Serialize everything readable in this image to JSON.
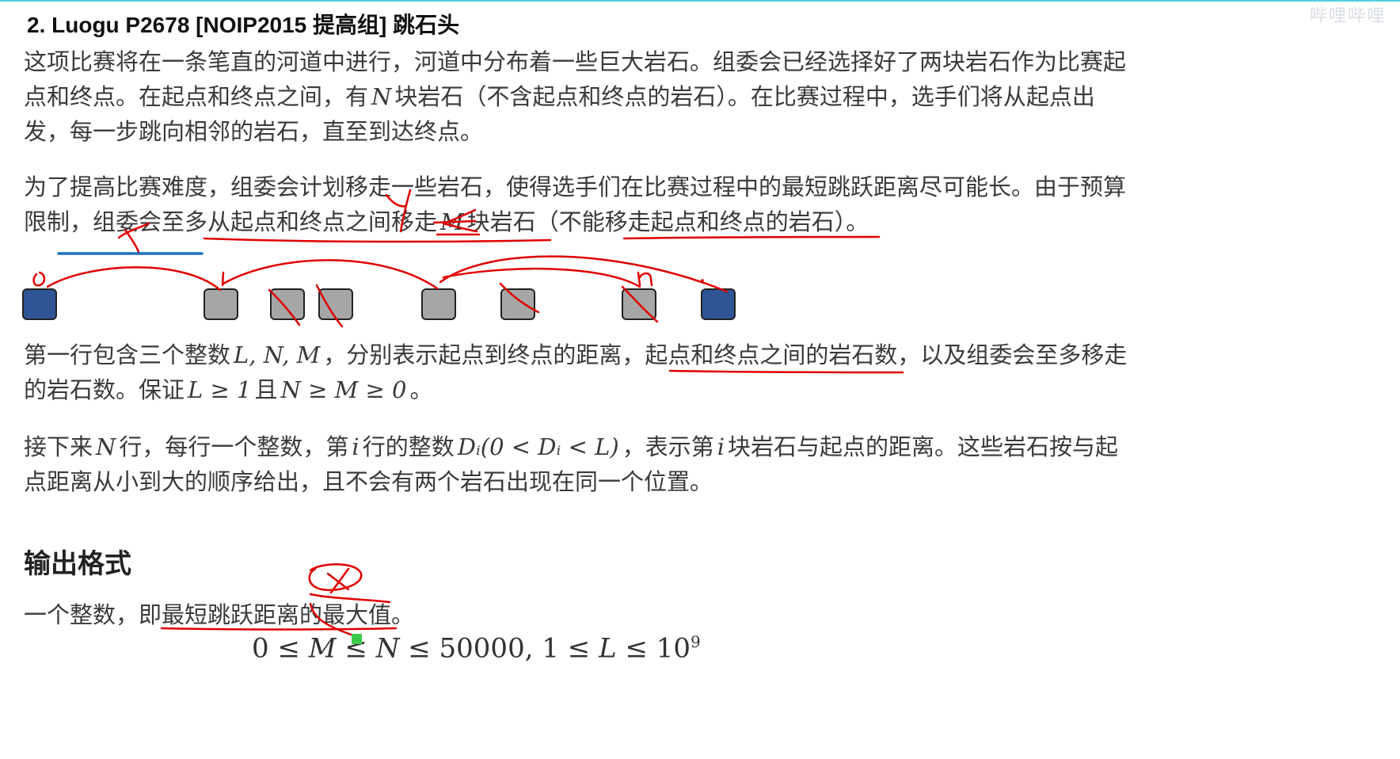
{
  "header": {
    "title": "2. Luogu P2678 [NOIP2015 提高组] 跳石头",
    "watermark": "哔哩哔哩"
  },
  "problem": {
    "p1": {
      "a": "这项比赛将在一条笔直的河道中进行，河道中分布着一些巨大岩石。组委会已经选择好了两块岩石作为比赛起点和终点。在起点和终点之间，有",
      "n": "N",
      "b": "块岩石（不含起点和终点的岩石）。在比赛过程中，选手们将从起点出发，每一步跳向相邻的岩石，直至到达终点。"
    },
    "p2": {
      "a": "为了提高比赛难度，组委会计划移走一些岩石，使得选手们在比赛过程中的最短跳跃距离尽可能长。由于预算限制，组委会至多从起点和终点之间移走",
      "m": "M",
      "b": "块岩石（不能移走起点和终点的岩石）。"
    },
    "p3": {
      "a": "第一行包含三个整数",
      "vars": "L, N, M",
      "b": "，分别表示起点到终点的距离，起点和终点之间的岩石数，以及组委会至多移走的岩石数。保证",
      "cond": "L ≥ 1",
      "c": "且",
      "cond2": "N ≥ M ≥ 0",
      "d": "。"
    },
    "p4": {
      "a": "接下来",
      "n": "N",
      "b": "行，每行一个整数，第",
      "i": "i",
      "c": "行的整数",
      "di": "Dᵢ(0 < Dᵢ < L)",
      "d": "，表示第",
      "i2": "i",
      "e": "块岩石与起点的距离。这些岩石按与起点距离从小到大的顺序给出，且不会有两个岩石出现在同一个位置。"
    },
    "output_heading": "输出格式",
    "output_text": "一个整数，即最短跳跃距离的最大值。",
    "constraint": {
      "a": "0 ≤ ",
      "m": "M",
      "b": " ≤ ",
      "n": "N",
      "c": " ≤ 50000, 1 ≤ ",
      "l": "L",
      "d": " ≤ 10",
      "exp": "9"
    }
  },
  "diagram": {
    "stones": [
      "end",
      "mid",
      "mid",
      "mid",
      "mid",
      "mid",
      "mid",
      "end"
    ],
    "labels": {
      "start": "0",
      "first": "1",
      "last": "n"
    }
  },
  "annotations": {
    "x1": "x",
    "y": "y",
    "x2": "x"
  },
  "colors": {
    "stone_end": "#2f5597",
    "stone_mid": "#a6a6a6",
    "ink_red": "#e00000",
    "ink_blue": "#1f6fbf",
    "cursor": "#3ec94b"
  }
}
